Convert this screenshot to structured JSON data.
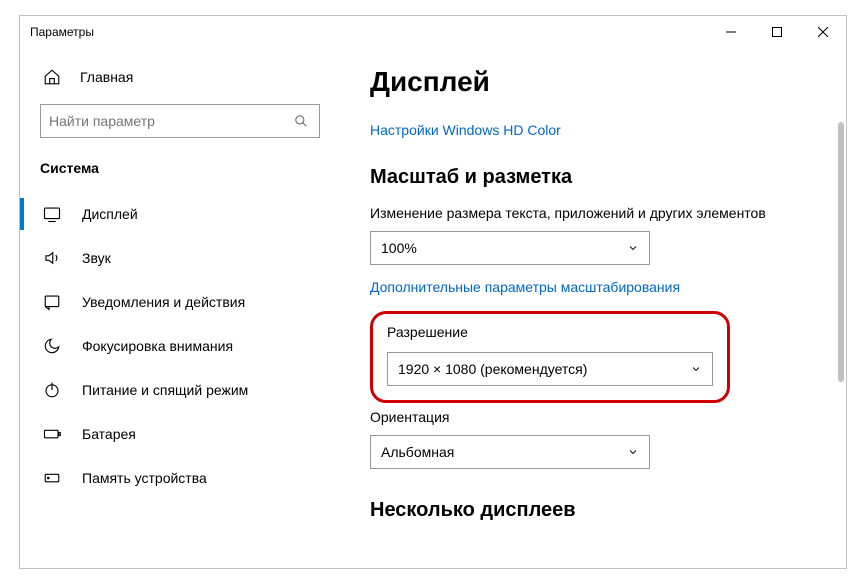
{
  "window": {
    "title": "Параметры"
  },
  "sidebar": {
    "home": "Главная",
    "searchPlaceholder": "Найти параметр",
    "groupTitle": "Система",
    "items": [
      {
        "label": "Дисплей"
      },
      {
        "label": "Звук"
      },
      {
        "label": "Уведомления и действия"
      },
      {
        "label": "Фокусировка внимания"
      },
      {
        "label": "Питание и спящий режим"
      },
      {
        "label": "Батарея"
      },
      {
        "label": "Память устройства"
      }
    ]
  },
  "content": {
    "pageTitle": "Дисплей",
    "hdLink": "Настройки Windows HD Color",
    "scaleHeading": "Масштаб и разметка",
    "scaleLabel": "Изменение размера текста, приложений и других элементов",
    "scaleValue": "100%",
    "advScaleLink": "Дополнительные параметры масштабирования",
    "resolutionLabel": "Разрешение",
    "resolutionValue": "1920 × 1080 (рекомендуется)",
    "orientationLabel": "Ориентация",
    "orientationValue": "Альбомная",
    "multiHeading": "Несколько дисплеев"
  }
}
